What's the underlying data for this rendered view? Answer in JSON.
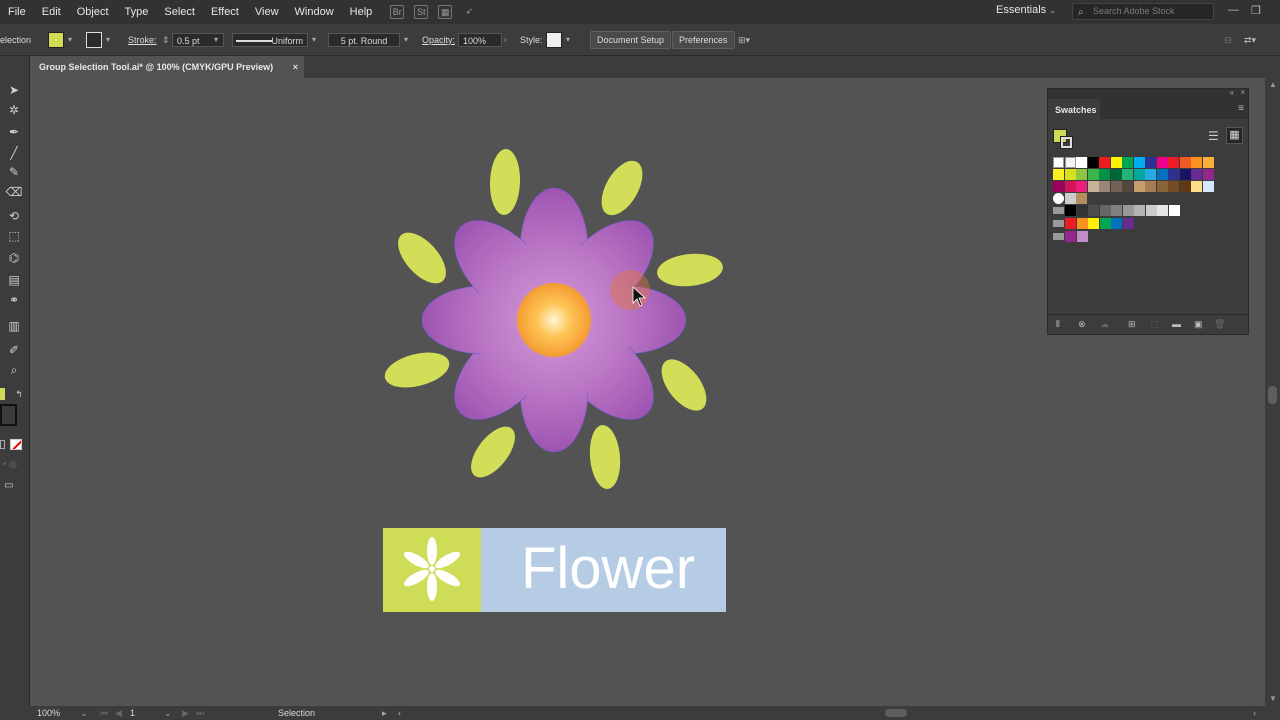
{
  "menu": [
    "File",
    "Edit",
    "Object",
    "Type",
    "Select",
    "Effect",
    "View",
    "Window",
    "Help"
  ],
  "menubar_icons": {
    "bridge": "Br",
    "stock": "St"
  },
  "workspace": "Essentials",
  "search_placeholder": "Search Adobe Stock",
  "control": {
    "tool_name": "election",
    "fill_color": "#d0dc58",
    "stroke_label": "Stroke:",
    "stroke_weight": "0.5 pt",
    "stroke_profile": "Uniform",
    "brush": "5 pt. Round",
    "opacity_label": "Opacity:",
    "opacity": "100%",
    "style_label": "Style:",
    "document_setup": "Document Setup",
    "preferences": "Preferences"
  },
  "tab": {
    "title": "Group Selection Tool.ai* @ 100% (CMYK/GPU Preview)",
    "close": "×"
  },
  "swatches": {
    "title": "Swatches"
  },
  "artwork": {
    "logo_text": "Flower",
    "petal_color": "#b56fc1",
    "center_color": "#f6a63c",
    "leaf_color": "#d2de58",
    "logo_green": "#cfdc58",
    "logo_blue": "#b5cce4"
  },
  "status": {
    "zoom": "100%",
    "artboard": "1",
    "tool": "Selection"
  }
}
